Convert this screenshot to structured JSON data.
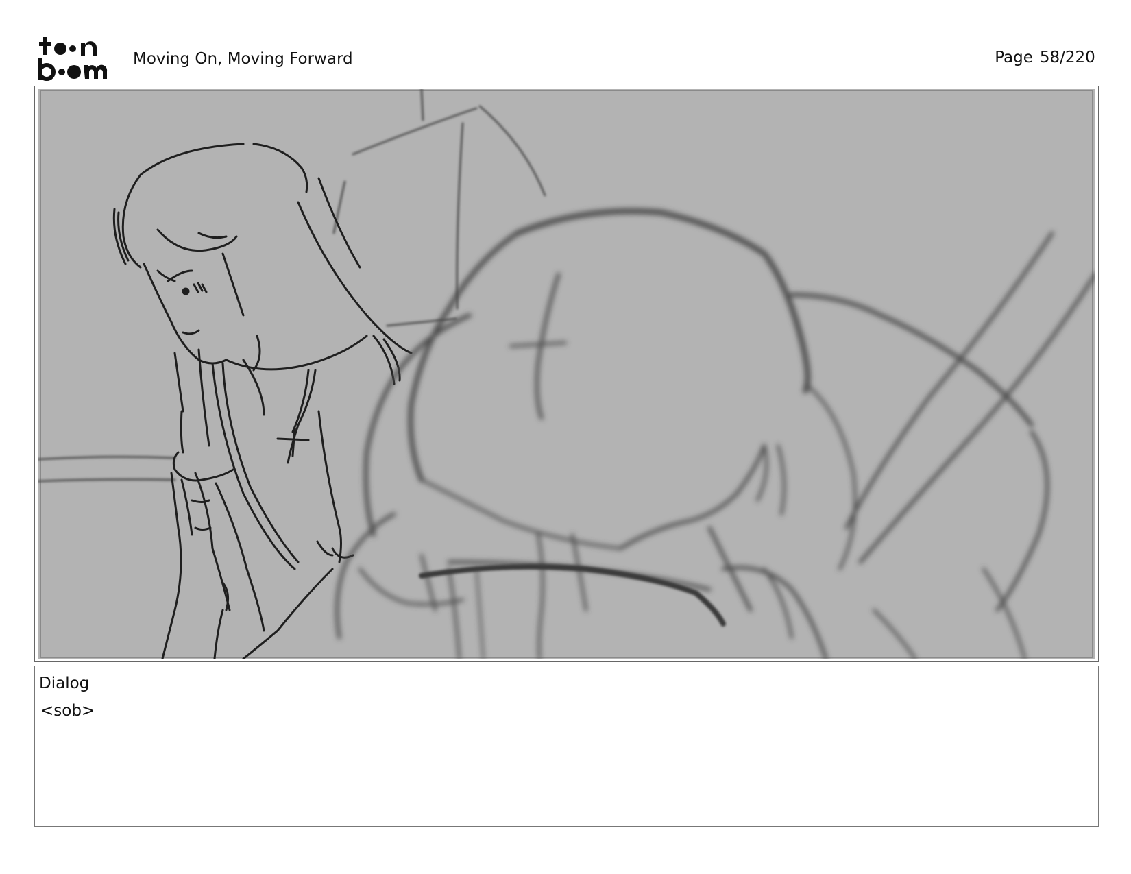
{
  "header": {
    "logo_text": "toonboom",
    "title": "Moving On, Moving Forward",
    "page_label": "Page",
    "page_number": "58/220"
  },
  "panel": {
    "art": "storyboard-sketch"
  },
  "dialog": {
    "label": "Dialog",
    "text": "<sob>"
  }
}
